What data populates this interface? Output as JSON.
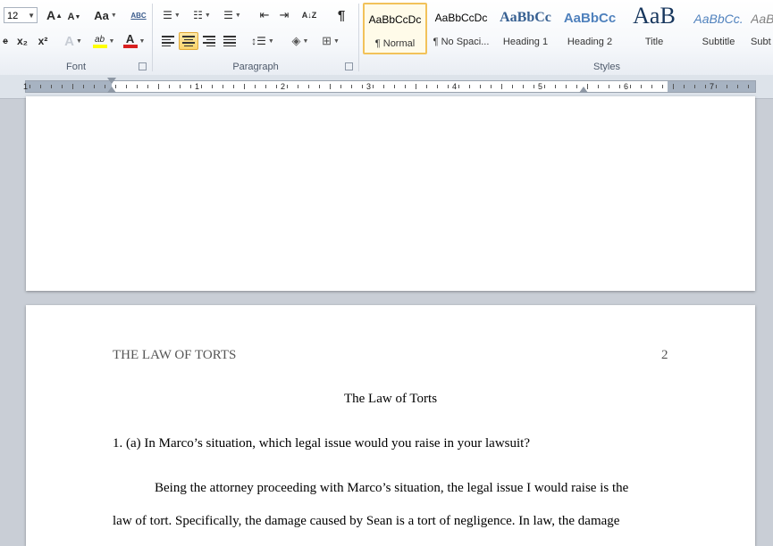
{
  "ribbon": {
    "font": {
      "label": "Font",
      "size_value": "12",
      "grow_label": "A",
      "shrink_label": "A",
      "case_label": "Aa",
      "clear_label": "ABC",
      "strike_label": "abc",
      "subscript_label": "x₂",
      "superscript_label": "x²",
      "effects_label": "A",
      "highlight_label": "ab",
      "fontcolor_label": "A",
      "highlight_color": "#ffff00",
      "fontcolor_color": "#d82020"
    },
    "paragraph": {
      "label": "Paragraph",
      "sort_label": "A↓Z",
      "pilcrow_label": "¶"
    },
    "styles": {
      "label": "Styles",
      "items": [
        {
          "preview": "AaBbCcDc",
          "name": "¶ Normal"
        },
        {
          "preview": "AaBbCcDc",
          "name": "¶ No Spaci..."
        },
        {
          "preview": "AaBbCc",
          "name": "Heading 1"
        },
        {
          "preview": "AaBbCc",
          "name": "Heading 2"
        },
        {
          "preview": "AaB",
          "name": "Title"
        },
        {
          "preview": "AaBbCc.",
          "name": "Subtitle"
        },
        {
          "preview": "AaB",
          "name": "Subt"
        }
      ],
      "heading_color": "#365f91",
      "heading2_color": "#4f81bd",
      "title_color": "#17365d",
      "subtitle_color": "#4f81bd"
    }
  },
  "ruler": {
    "numbers": [
      "1",
      "1",
      "2",
      "3",
      "4",
      "5",
      "6",
      "7"
    ]
  },
  "document": {
    "running_head": "THE LAW OF TORTS",
    "page_number": "2",
    "title": "The Law of Torts",
    "question": "1. (a) In Marco’s situation, which legal issue would you raise in your lawsuit?",
    "para_line1": "Being the attorney proceeding with Marco’s situation, the legal issue I would raise is the",
    "para_line2": "law of tort. Specifically, the damage caused by Sean is a tort of negligence. In law, the damage"
  }
}
